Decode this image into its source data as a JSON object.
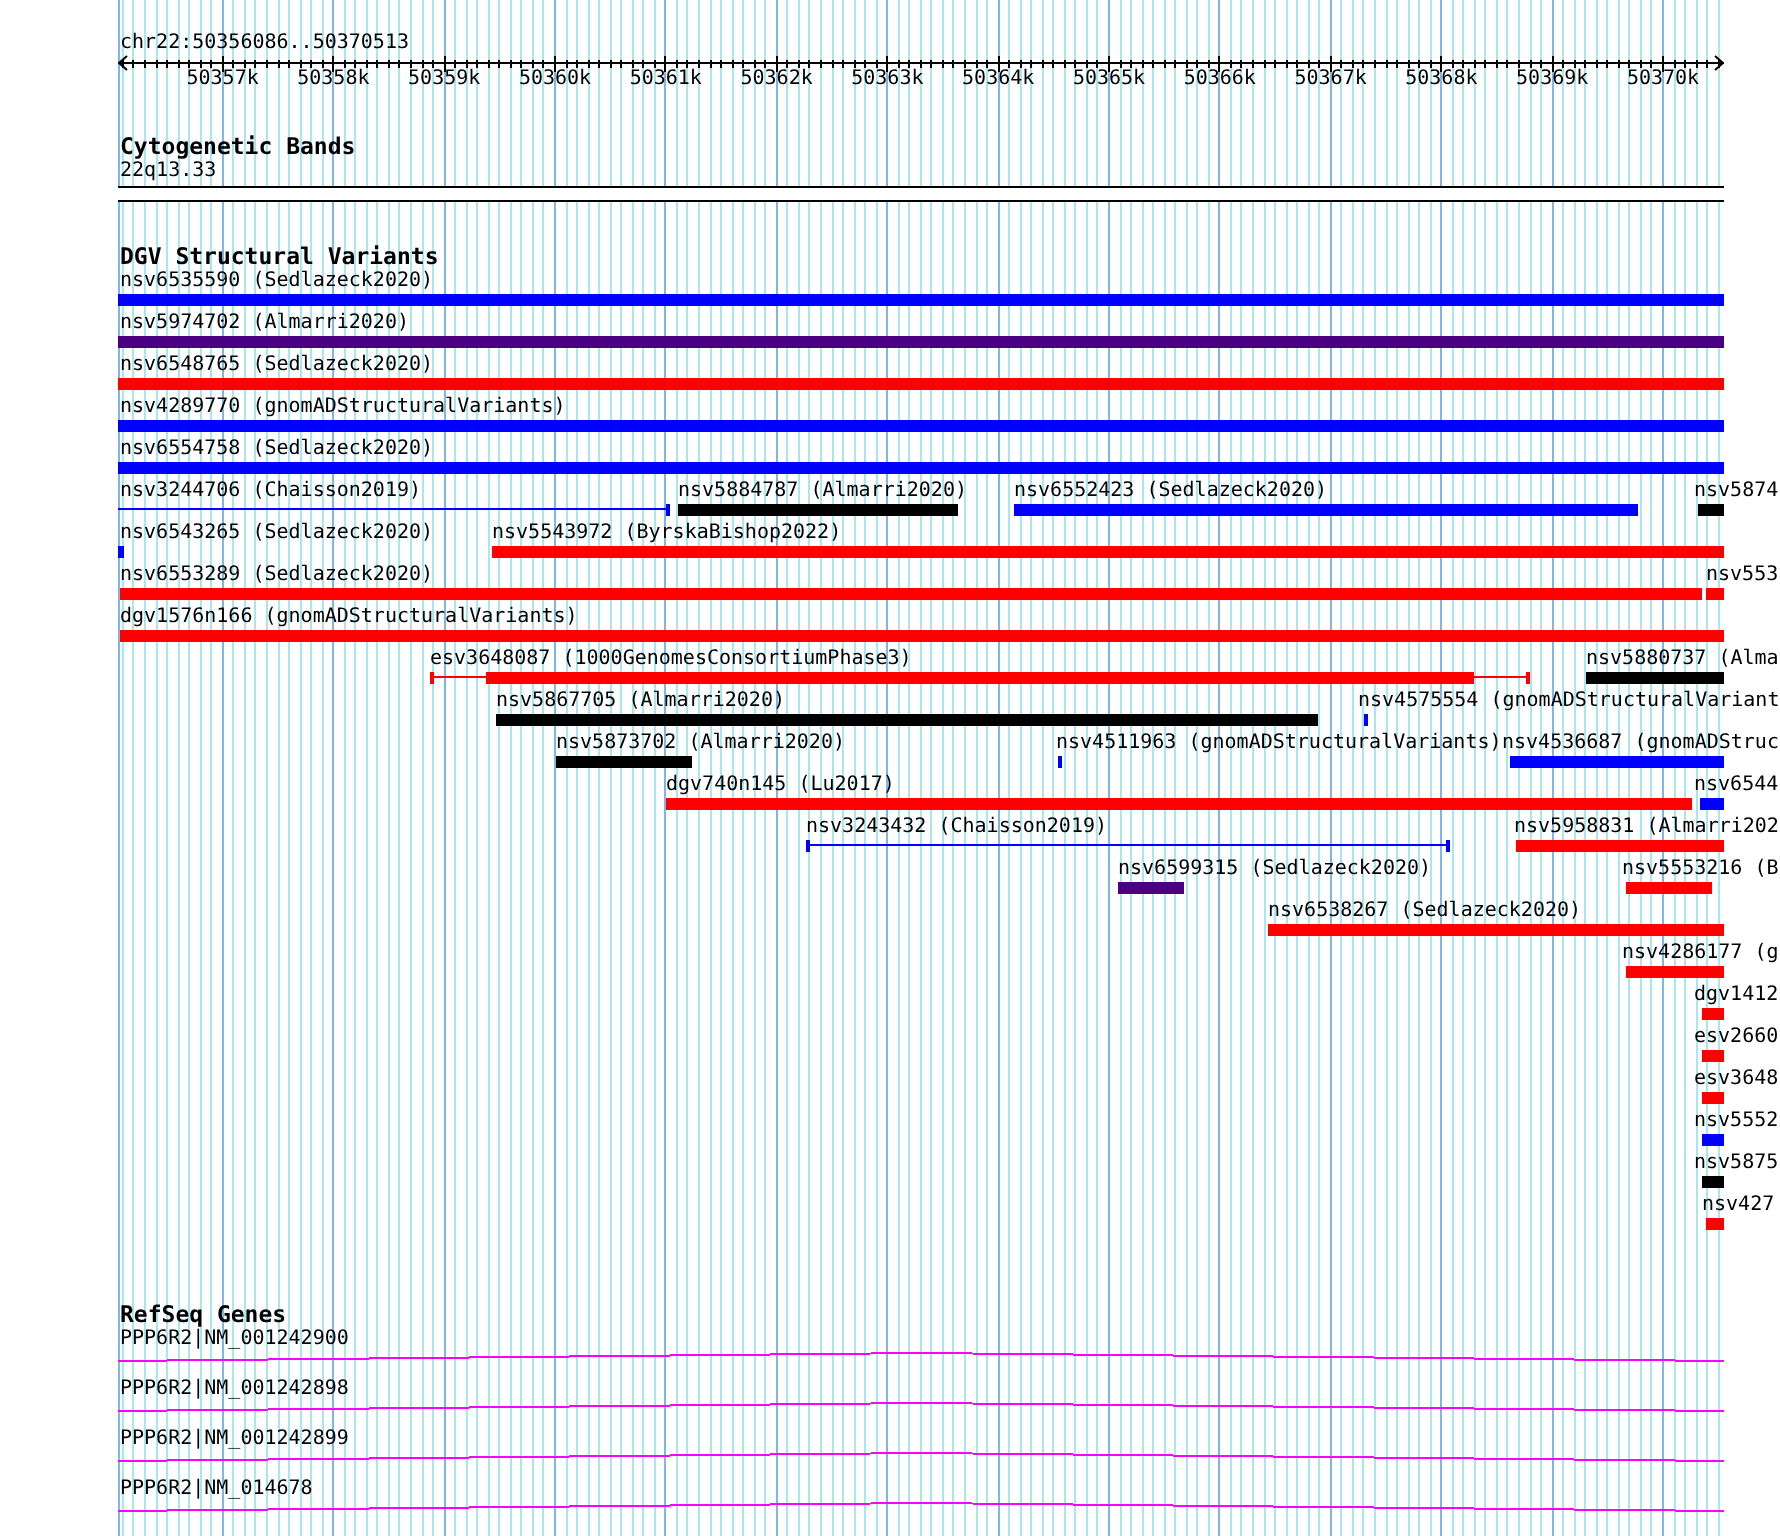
{
  "ruler": {
    "region": "chr22:50356086..50370513",
    "tick_labels": [
      "50357k",
      "50358k",
      "50359k",
      "50360k",
      "50361k",
      "50362k",
      "50363k",
      "50364k",
      "50365k",
      "50366k",
      "50367k",
      "50368k",
      "50369k",
      "50370k"
    ]
  },
  "cytogenetic_bands": {
    "title": "Cytogenetic Bands",
    "band": "22q13.33"
  },
  "dgv_structural_variants": {
    "title": "DGV Structural Variants",
    "rows": [
      {
        "features": [
          {
            "label": "nsv6535590 (Sedlazeck2020)",
            "kind": "bar",
            "color": "#0000ff"
          }
        ]
      },
      {
        "features": [
          {
            "label": "nsv5974702 (Almarri2020)",
            "kind": "bar",
            "color": "#4b0082"
          }
        ]
      },
      {
        "features": [
          {
            "label": "nsv6548765 (Sedlazeck2020)",
            "kind": "bar",
            "color": "#ff0000"
          }
        ]
      },
      {
        "features": [
          {
            "label": "nsv4289770 (gnomADStructuralVariants)",
            "kind": "bar",
            "color": "#0000ff"
          }
        ]
      },
      {
        "features": [
          {
            "label": "nsv6554758 (Sedlazeck2020)",
            "kind": "bar",
            "color": "#0000ff"
          }
        ]
      },
      {
        "features": [
          {
            "label": "nsv3244706 (Chaisson2019)",
            "kind": "interval",
            "color": "#0000ff"
          },
          {
            "label": "nsv5884787 (Almarri2020)",
            "kind": "bar",
            "color": "#000000"
          },
          {
            "label": "nsv6552423 (Sedlazeck2020)",
            "kind": "bar",
            "color": "#0000ff"
          },
          {
            "label": "nsv5874",
            "kind": "bar",
            "color": "#000000"
          }
        ]
      },
      {
        "features": [
          {
            "label": "nsv6543265 (Sedlazeck2020)",
            "kind": "bar",
            "color": "#0000ff"
          },
          {
            "label": "nsv5543972 (ByrskaBishop2022)",
            "kind": "bar",
            "color": "#ff0000"
          }
        ]
      },
      {
        "features": [
          {
            "label": "nsv6553289 (Sedlazeck2020)",
            "kind": "bar",
            "color": "#ff0000"
          },
          {
            "label": "nsv553",
            "kind": "bar",
            "color": "#ff0000"
          }
        ]
      },
      {
        "features": [
          {
            "label": "dgv1576n166 (gnomADStructuralVariants)",
            "kind": "bar",
            "color": "#ff0000"
          }
        ]
      },
      {
        "features": [
          {
            "label": "esv3648087 (1000GenomesConsortiumPhase3)",
            "kind": "bar_interval",
            "color": "#ff0000"
          },
          {
            "label": "nsv5880737 (Alma",
            "kind": "bar",
            "color": "#000000"
          }
        ]
      },
      {
        "features": [
          {
            "label": "nsv5867705 (Almarri2020)",
            "kind": "bar",
            "color": "#000000"
          },
          {
            "label": "nsv4575554 (gnomADStructuralVariant",
            "kind": "bar",
            "color": "#0000ff"
          }
        ]
      },
      {
        "features": [
          {
            "label": "nsv5873702 (Almarri2020)",
            "kind": "bar",
            "color": "#000000"
          },
          {
            "label": "nsv4511963 (gnomADStructuralVariants)",
            "kind": "bar",
            "color": "#0000ff"
          },
          {
            "label": "nsv4536687 (gnomADStruc",
            "kind": "bar",
            "color": "#0000ff"
          }
        ]
      },
      {
        "features": [
          {
            "label": "dgv740n145 (Lu2017)",
            "kind": "bar",
            "color": "#ff0000"
          },
          {
            "label": "nsv6544",
            "kind": "bar",
            "color": "#0000ff"
          }
        ]
      },
      {
        "features": [
          {
            "label": "nsv3243432 (Chaisson2019)",
            "kind": "interval",
            "color": "#0000ff"
          },
          {
            "label": "nsv5958831 (Almarri202",
            "kind": "bar",
            "color": "#ff0000"
          }
        ]
      },
      {
        "features": [
          {
            "label": "nsv6599315 (Sedlazeck2020)",
            "kind": "bar",
            "color": "#4b0082"
          },
          {
            "label": "nsv5553216 (B",
            "kind": "bar",
            "color": "#ff0000"
          }
        ]
      },
      {
        "features": [
          {
            "label": "nsv6538267 (Sedlazeck2020)",
            "kind": "bar",
            "color": "#ff0000"
          }
        ]
      },
      {
        "features": [
          {
            "label": "nsv4286177 (g",
            "kind": "bar",
            "color": "#ff0000"
          }
        ]
      },
      {
        "features": [
          {
            "label": "dgv1412",
            "kind": "bar",
            "color": "#ff0000"
          }
        ]
      },
      {
        "features": [
          {
            "label": "esv2660",
            "kind": "bar",
            "color": "#ff0000"
          }
        ]
      },
      {
        "features": [
          {
            "label": "esv3648",
            "kind": "bar",
            "color": "#ff0000"
          }
        ]
      },
      {
        "features": [
          {
            "label": "nsv5552",
            "kind": "bar",
            "color": "#0000ff"
          }
        ]
      },
      {
        "features": [
          {
            "label": "nsv5875",
            "kind": "bar",
            "color": "#000000"
          }
        ]
      },
      {
        "features": [
          {
            "label": "nsv427",
            "kind": "bar",
            "color": "#ff0000"
          }
        ]
      }
    ]
  },
  "refseq_genes": {
    "title": "RefSeq Genes",
    "transcripts": [
      {
        "label": "PPP6R2|NM_001242900"
      },
      {
        "label": "PPP6R2|NM_001242898"
      },
      {
        "label": "PPP6R2|NM_001242899"
      },
      {
        "label": "PPP6R2|NM_014678"
      }
    ]
  }
}
